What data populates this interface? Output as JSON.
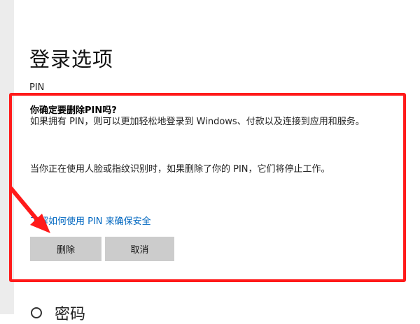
{
  "page": {
    "title": "登录选项",
    "section_label": "PIN"
  },
  "dialog": {
    "question": "你确定要删除PIN吗?",
    "paragraph1": "如果拥有 PIN，则可以更加轻松地登录到 Windows、付款以及连接到应用和服务。",
    "paragraph2": "当你正在使用人脸或指纹识别时，如果删除了你的 PIN，它们将停止工作。",
    "link_text": "了解如何使用 PIN 来确保安全",
    "delete_label": "删除",
    "cancel_label": "取消"
  },
  "next_section": {
    "label": "密码",
    "icon": "key-icon"
  },
  "colors": {
    "highlight": "#ff1a1a",
    "link": "#0067c0",
    "button_bg": "#cccccc"
  }
}
